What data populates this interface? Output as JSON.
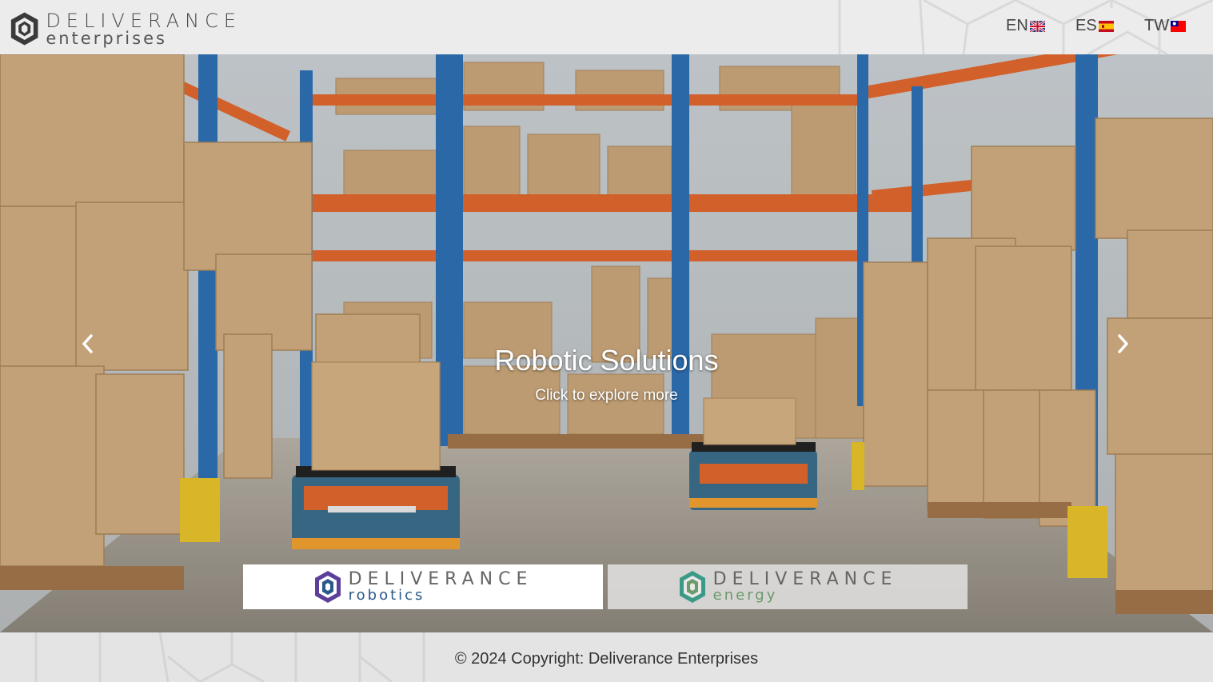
{
  "header": {
    "logo": {
      "word": "DELIVERANCE",
      "sub": "enterprises"
    },
    "languages": [
      {
        "code": "EN",
        "flag": "uk-flag"
      },
      {
        "code": "ES",
        "flag": "spain-flag"
      },
      {
        "code": "TW",
        "flag": "taiwan-flag"
      }
    ]
  },
  "hero": {
    "title": "Robotic Solutions",
    "subtitle": "Click to explore more",
    "prev_icon": "chevron-left-icon",
    "next_icon": "chevron-right-icon"
  },
  "brands": [
    {
      "word": "DELIVERANCE",
      "sub": "robotics",
      "accent": "#5b3f9a",
      "sub_color": "#2a5a8a"
    },
    {
      "word": "DELIVERANCE",
      "sub": "energy",
      "accent": "#3b9a86",
      "sub_color": "#6a9a6a"
    }
  ],
  "footer": {
    "copyright": "© 2024 Copyright: Deliverance Enterprises"
  },
  "colors": {
    "header_bg": "#ececec",
    "footer_bg": "#e4e4e4",
    "rack_blue": "#2d6fb3",
    "rack_orange": "#e0672e",
    "box": "#c9a57a"
  }
}
